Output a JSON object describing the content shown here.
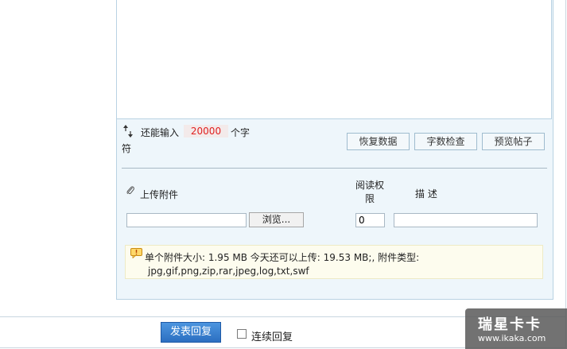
{
  "editor": {
    "counter_prefix": "还能输入",
    "counter_value": "20000",
    "counter_suffix_1": "个字",
    "counter_suffix_2": "符"
  },
  "editor_buttons": {
    "restore": "恢复数据",
    "word_check": "字数检查",
    "preview": "预览帖子"
  },
  "attachment": {
    "upload_label": "上传附件",
    "permission_label_1": "阅读权",
    "permission_label_2": "限",
    "description_label": "描 述",
    "browse_button": "浏览...",
    "permission_value": "0",
    "file_value": "",
    "description_value": ""
  },
  "info": {
    "line1": "单个附件大小: 1.95 MB  今天还可以上传: 19.53 MB;,  附件类型:",
    "line2": "jpg,gif,png,zip,rar,jpeg,log,txt,swf"
  },
  "footer": {
    "submit_label": "发表回复",
    "continuous_label": "连续回复",
    "continuous_checked": false
  },
  "watermark": {
    "title": "瑞星卡卡",
    "url": "www.ikaka.com"
  },
  "colors": {
    "counter_text": "#e02020",
    "submit_bg": "#2c6fc1",
    "panel_bg": "#eef6fb"
  }
}
